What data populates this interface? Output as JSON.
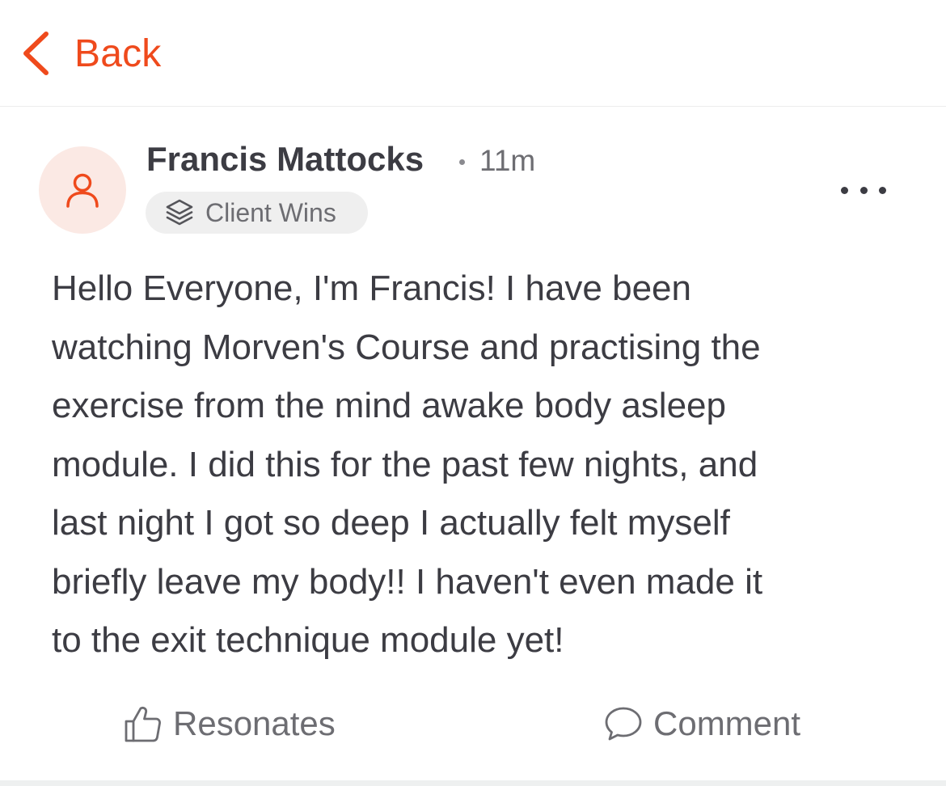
{
  "nav": {
    "back_label": "Back",
    "back_icon": "chevron-left-icon"
  },
  "post": {
    "author": "Francis Mattocks",
    "separator": "•",
    "time_ago": "11m",
    "avatar_icon": "user-icon",
    "category": {
      "icon": "layers-icon",
      "label": "Client Wins"
    },
    "more_icon": "more-horizontal-icon",
    "body_lines": [
      "Hello Everyone, I'm Francis! I have been",
      "watching Morven's Course and practising the",
      "exercise from the mind awake body asleep",
      "module. I did this for the past few nights, and",
      "last night I got so deep I actually felt myself",
      "briefly leave my body!! I haven't even made it",
      "to the exit technique module yet!"
    ],
    "actions": {
      "resonates": {
        "label": "Resonates",
        "icon": "thumbs-up-icon"
      },
      "comment": {
        "label": "Comment",
        "icon": "comment-bubble-icon"
      }
    }
  },
  "colors": {
    "accent": "#ef4a1c",
    "avatar_bg": "#fbe9e4",
    "text_primary": "#3c3c43",
    "text_secondary": "#6d6d72",
    "tag_bg": "#efefef"
  }
}
